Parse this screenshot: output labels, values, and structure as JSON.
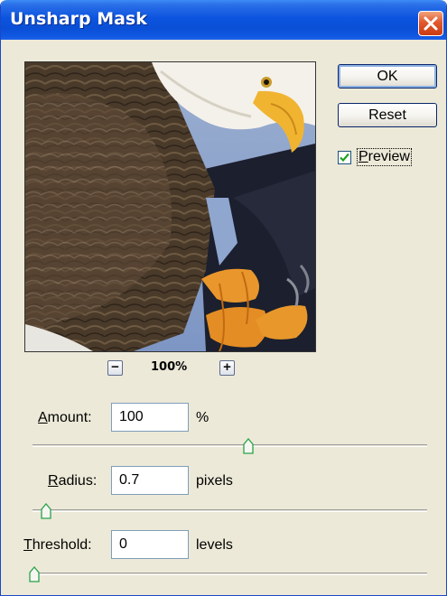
{
  "dialog": {
    "title": "Unsharp Mask"
  },
  "buttons": {
    "ok": "OK",
    "reset": "Reset"
  },
  "preview_toggle": {
    "label": "Preview",
    "checked": true
  },
  "zoom": {
    "level": "100%",
    "out_symbol": "−",
    "in_symbol": "+"
  },
  "amount": {
    "label": "Amount:",
    "value": "100",
    "unit": "%",
    "slider_fraction": 0.54
  },
  "radius": {
    "label": "Radius:",
    "value": "0.7",
    "unit": "pixels",
    "slider_fraction": 0.02
  },
  "threshold": {
    "label": "Threshold:",
    "value": "0",
    "unit": "levels",
    "slider_fraction": 0.0
  },
  "colors": {
    "titlebar": "#0c54df",
    "dialog_bg": "#ece9d8",
    "close_button": "#e2582d",
    "check_mark": "#21a121"
  }
}
